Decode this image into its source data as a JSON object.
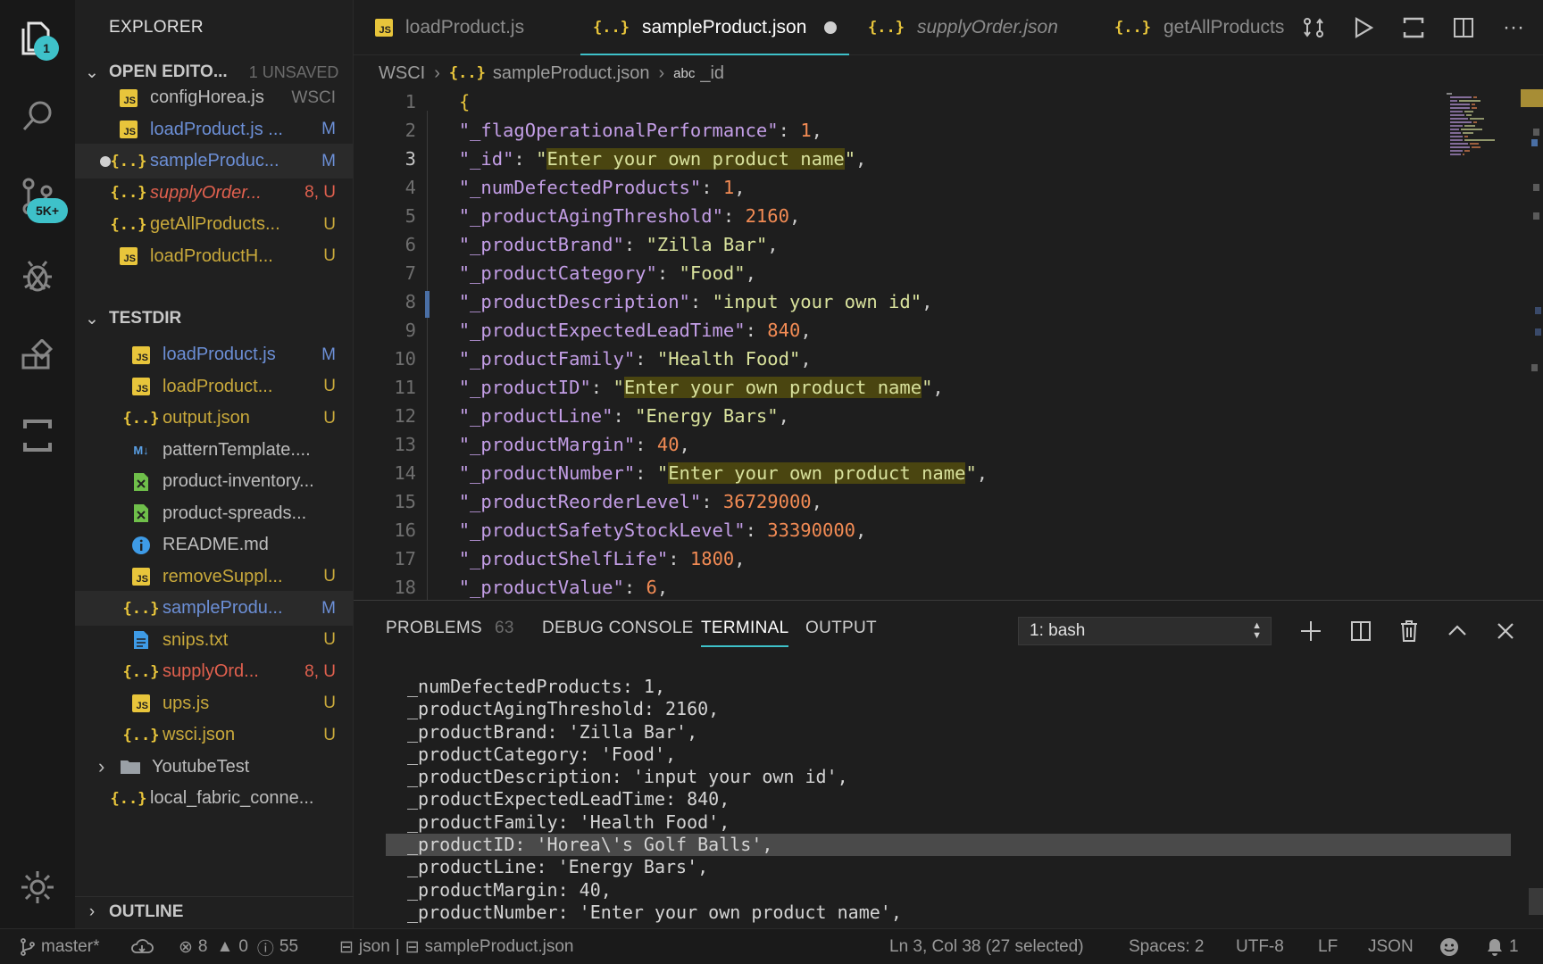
{
  "activity": {
    "explorer_badge": "1",
    "scm_badge": "5K+"
  },
  "sidebar": {
    "title": "EXPLORER",
    "open_editors": {
      "label": "OPEN EDITO...",
      "unsaved": "1 UNSAVED",
      "items": [
        {
          "name": "configHorea.js",
          "status": "WSCI",
          "type": "js",
          "color": "#bdbdbd"
        },
        {
          "name": "loadProduct.js ...",
          "status": "M",
          "type": "js",
          "color": "#6c8fd6"
        },
        {
          "name": "sampleProduc...",
          "status": "M",
          "type": "json",
          "color": "#6c8fd6"
        },
        {
          "name": "supplyOrder...",
          "status": "8, U",
          "type": "json",
          "color": "#e0604e"
        },
        {
          "name": "getAllProducts...",
          "status": "U",
          "type": "json",
          "color": "#c9a93b"
        },
        {
          "name": "loadProductH...",
          "status": "U",
          "type": "js",
          "color": "#c9a93b"
        }
      ]
    },
    "testdir": {
      "label": "TESTDIR",
      "items": [
        {
          "name": "loadProduct.js",
          "status": "M",
          "type": "js",
          "color": "#6c8fd6"
        },
        {
          "name": "loadProduct...",
          "status": "U",
          "type": "js",
          "color": "#c9a93b"
        },
        {
          "name": "output.json",
          "status": "U",
          "type": "json",
          "color": "#c9a93b"
        },
        {
          "name": "patternTemplate....",
          "status": "",
          "type": "md",
          "color": "#bdbdbd"
        },
        {
          "name": "product-inventory...",
          "status": "",
          "type": "xls",
          "color": "#bdbdbd"
        },
        {
          "name": "product-spreads...",
          "status": "",
          "type": "xls",
          "color": "#bdbdbd"
        },
        {
          "name": "README.md",
          "status": "",
          "type": "info",
          "color": "#bdbdbd"
        },
        {
          "name": "removeSuppl...",
          "status": "U",
          "type": "js",
          "color": "#c9a93b"
        },
        {
          "name": "sampleProdu...",
          "status": "M",
          "type": "json",
          "color": "#6c8fd6"
        },
        {
          "name": "snips.txt",
          "status": "U",
          "type": "txt",
          "color": "#c9a93b"
        },
        {
          "name": "supplyOrd...",
          "status": "8, U",
          "type": "json",
          "color": "#e0604e"
        },
        {
          "name": "ups.js",
          "status": "U",
          "type": "js",
          "color": "#c9a93b"
        },
        {
          "name": "wsci.json",
          "status": "U",
          "type": "json",
          "color": "#c9a93b"
        },
        {
          "name": "YoutubeTest",
          "status": "",
          "type": "folder",
          "color": "#bdbdbd"
        },
        {
          "name": "local_fabric_conne...",
          "status": "",
          "type": "json",
          "color": "#bdbdbd"
        }
      ]
    },
    "outline": "OUTLINE"
  },
  "tabs": [
    {
      "label": "loadProduct.js",
      "type": "js"
    },
    {
      "label": "sampleProduct.json",
      "type": "json"
    },
    {
      "label": "supplyOrder.json",
      "type": "json"
    },
    {
      "label": "getAllProducts",
      "type": "json"
    }
  ],
  "breadcrumb": {
    "folder": "WSCI",
    "file": "sampleProduct.json",
    "symbol_prefix": "abc",
    "symbol": "_id"
  },
  "editor": {
    "lines": [
      {
        "num": "1",
        "key": "",
        "value": "",
        "kind": "open"
      },
      {
        "num": "2",
        "key": "_flagOperationalPerformance",
        "value": "1",
        "kind": "num"
      },
      {
        "num": "3",
        "key": "_id",
        "value": "Enter your own product name",
        "kind": "str-hl"
      },
      {
        "num": "4",
        "key": "_numDefectedProducts",
        "value": "1",
        "kind": "num"
      },
      {
        "num": "5",
        "key": "_productAgingThreshold",
        "value": "2160",
        "kind": "num"
      },
      {
        "num": "6",
        "key": "_productBrand",
        "value": "Zilla Bar",
        "kind": "str"
      },
      {
        "num": "7",
        "key": "_productCategory",
        "value": "Food",
        "kind": "str"
      },
      {
        "num": "8",
        "key": "_productDescription",
        "value": "input your own id",
        "kind": "str"
      },
      {
        "num": "9",
        "key": "_productExpectedLeadTime",
        "value": "840",
        "kind": "num"
      },
      {
        "num": "10",
        "key": "_productFamily",
        "value": "Health Food",
        "kind": "str"
      },
      {
        "num": "11",
        "key": "_productID",
        "value": "Enter your own product name",
        "kind": "str-hl"
      },
      {
        "num": "12",
        "key": "_productLine",
        "value": "Energy Bars",
        "kind": "str"
      },
      {
        "num": "13",
        "key": "_productMargin",
        "value": "40",
        "kind": "num"
      },
      {
        "num": "14",
        "key": "_productNumber",
        "value": "Enter your own product name",
        "kind": "str-hl"
      },
      {
        "num": "15",
        "key": "_productReorderLevel",
        "value": "36729000",
        "kind": "num"
      },
      {
        "num": "16",
        "key": "_productSafetyStockLevel",
        "value": "33390000",
        "kind": "num"
      },
      {
        "num": "17",
        "key": "_productShelfLife",
        "value": "1800",
        "kind": "num"
      },
      {
        "num": "18",
        "key": "_productValue",
        "value": "6",
        "kind": "num"
      }
    ]
  },
  "panel": {
    "tabs": {
      "problems": "PROBLEMS",
      "problems_count": "63",
      "debug": "DEBUG CONSOLE",
      "terminal": "TERMINAL",
      "output": "OUTPUT"
    },
    "terminal_select": "1: bash",
    "terminal_lines": [
      "_numDefectedProducts: 1,",
      "_productAgingThreshold: 2160,",
      "_productBrand: 'Zilla Bar',",
      "_productCategory: 'Food',",
      "_productDescription: 'input your own id',",
      "_productExpectedLeadTime: 840,",
      "_productFamily: 'Health Food',",
      "_productID: 'Horea\\'s Golf Balls',",
      "_productLine: 'Energy Bars',",
      "_productMargin: 40,",
      "_productNumber: 'Enter your own product name',"
    ],
    "highlighted_line": 7
  },
  "status": {
    "branch": "master*",
    "errors": "8",
    "warnings": "0",
    "infos": "55",
    "lang_mode": "json",
    "file": "sampleProduct.json",
    "position": "Ln 3, Col 38 (27 selected)",
    "spaces": "Spaces: 2",
    "encoding": "UTF-8",
    "eol": "LF",
    "language": "JSON",
    "notifications": "1"
  },
  "colors": {
    "accent": "#3ec1c9",
    "key": "#c39ee6",
    "string": "#d8e19c",
    "number": "#f28b54"
  }
}
